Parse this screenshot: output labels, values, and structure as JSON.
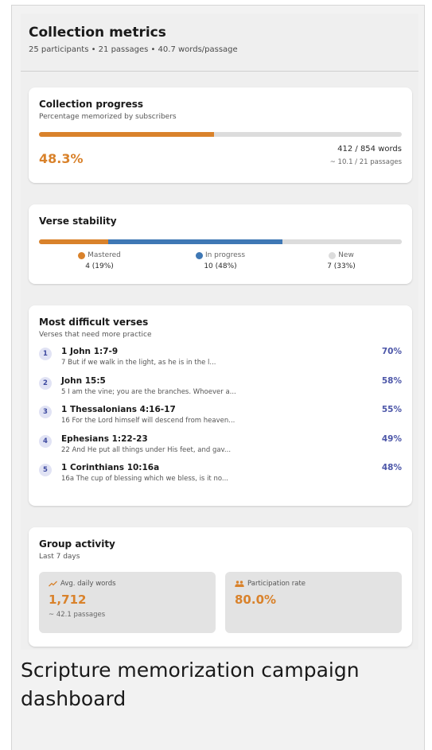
{
  "header": {
    "title": "Collection metrics",
    "subtitle": "25 participants • 21 passages • 40.7 words/passage"
  },
  "progress": {
    "title": "Collection progress",
    "subtitle": "Percentage memorized by subscribers",
    "percent_value": 48.3,
    "percent_label": "48.3%",
    "words": "412 / 854 words",
    "passages": "~ 10.1 / 21 passages",
    "colors": {
      "fill": "#d9822b",
      "track": "#dcdcdc"
    }
  },
  "stability": {
    "title": "Verse stability",
    "segments": [
      {
        "key": "mastered",
        "label": "Mastered",
        "value": "4 (19%)",
        "percent": 19,
        "color": "#d9822b"
      },
      {
        "key": "in_progress",
        "label": "In progress",
        "value": "10 (48%)",
        "percent": 48,
        "color": "#3f78b5"
      },
      {
        "key": "new",
        "label": "New",
        "value": "7 (33%)",
        "percent": 33,
        "color": "#dcdcdc"
      }
    ]
  },
  "difficult": {
    "title": "Most difficult verses",
    "subtitle": "Verses that need more practice",
    "items": [
      {
        "rank": "1",
        "ref": "1 John 1:7-9",
        "text": "7 But if we walk in the light, as he is in the l...",
        "pct": "70%"
      },
      {
        "rank": "2",
        "ref": "John 15:5",
        "text": "5 I am the vine; you are the branches. Whoever a...",
        "pct": "58%"
      },
      {
        "rank": "3",
        "ref": "1 Thessalonians 4:16-17",
        "text": "16 For the Lord himself will descend from heaven...",
        "pct": "55%"
      },
      {
        "rank": "4",
        "ref": "Ephesians 1:22-23",
        "text": "22 And He put all things under His feet, and gav...",
        "pct": "49%"
      },
      {
        "rank": "5",
        "ref": "1 Corinthians 10:16a",
        "text": "16a The cup of blessing which we bless, is it no...",
        "pct": "48%"
      }
    ]
  },
  "activity": {
    "title": "Group activity",
    "subtitle": "Last 7 days",
    "daily": {
      "icon": "trending-up-icon",
      "label": "Avg. daily words",
      "value": "1,712",
      "sub": "~ 42.1 passages"
    },
    "participation": {
      "icon": "group-icon",
      "label": "Participation rate",
      "value": "80.0%"
    }
  },
  "caption": "Scripture memorization campaign dashboard"
}
